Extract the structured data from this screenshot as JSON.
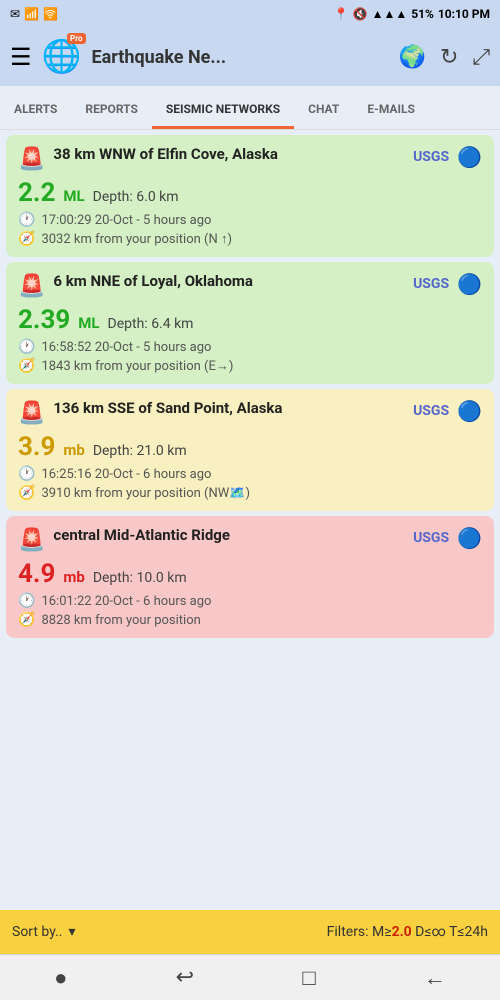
{
  "statusBar": {
    "icons_left": [
      "email-icon",
      "sim-icon",
      "wifi-calling-icon"
    ],
    "battery": "51%",
    "time": "10:10 PM",
    "signal": "▲▲▲",
    "wifi": "wifi"
  },
  "header": {
    "menu_label": "☰",
    "app_name": "Earthquake Ne...",
    "pro_badge": "Pro",
    "globe_icon": "🌐",
    "world_icon": "🌍",
    "refresh_icon": "↻",
    "expand_icon": "⤢"
  },
  "tabs": [
    {
      "id": "alerts",
      "label": "ALERTS",
      "active": false
    },
    {
      "id": "reports",
      "label": "REPORTS",
      "active": false
    },
    {
      "id": "seismic",
      "label": "SEISMIC NETWORKS",
      "active": true
    },
    {
      "id": "chat",
      "label": "CHAT",
      "active": false
    },
    {
      "id": "emails",
      "label": "E-MAILS",
      "active": false
    }
  ],
  "earthquakes": [
    {
      "id": 1,
      "color": "green",
      "location": "38 km WNW of Elfin Cove, Alaska",
      "magnitude": "2.2",
      "mag_type": "ML",
      "depth_label": "Depth:",
      "depth": "6.0 km",
      "time": "17:00:29 20-Oct - 5 hours ago",
      "distance": "3032 km from your position (N ↑)",
      "source": "USGS"
    },
    {
      "id": 2,
      "color": "green",
      "location": "6 km NNE of Loyal, Oklahoma",
      "magnitude": "2.39",
      "mag_type": "ML",
      "depth_label": "Depth:",
      "depth": "6.4 km",
      "time": "16:58:52 20-Oct - 5 hours ago",
      "distance": "1843 km from your position (E→)",
      "source": "USGS"
    },
    {
      "id": 3,
      "color": "yellow",
      "location": "136 km SSE of Sand Point, Alaska",
      "magnitude": "3.9",
      "mag_type": "mb",
      "depth_label": "Depth:",
      "depth": "21.0 km",
      "time": "16:25:16 20-Oct - 6 hours ago",
      "distance": "3910 km from your position (NW🗺️)",
      "source": "USGS"
    },
    {
      "id": 4,
      "color": "red",
      "location": "central Mid-Atlantic Ridge",
      "magnitude": "4.9",
      "mag_type": "mb",
      "depth_label": "Depth:",
      "depth": "10.0 km",
      "time": "16:01:22 20-Oct - 6 hours ago",
      "distance": "8828 km from your position",
      "source": "USGS"
    }
  ],
  "bottomBar": {
    "sort_label": "Sort by..",
    "dropdown_icon": "▾",
    "filters_prefix": "Filters: M≥",
    "filters_magnitude": "2.0",
    "filters_suffix": " D≤∞ T≤24h"
  },
  "navBar": {
    "home_icon": "●",
    "back_icon": "↩",
    "square_icon": "□",
    "arrow_icon": "←"
  }
}
